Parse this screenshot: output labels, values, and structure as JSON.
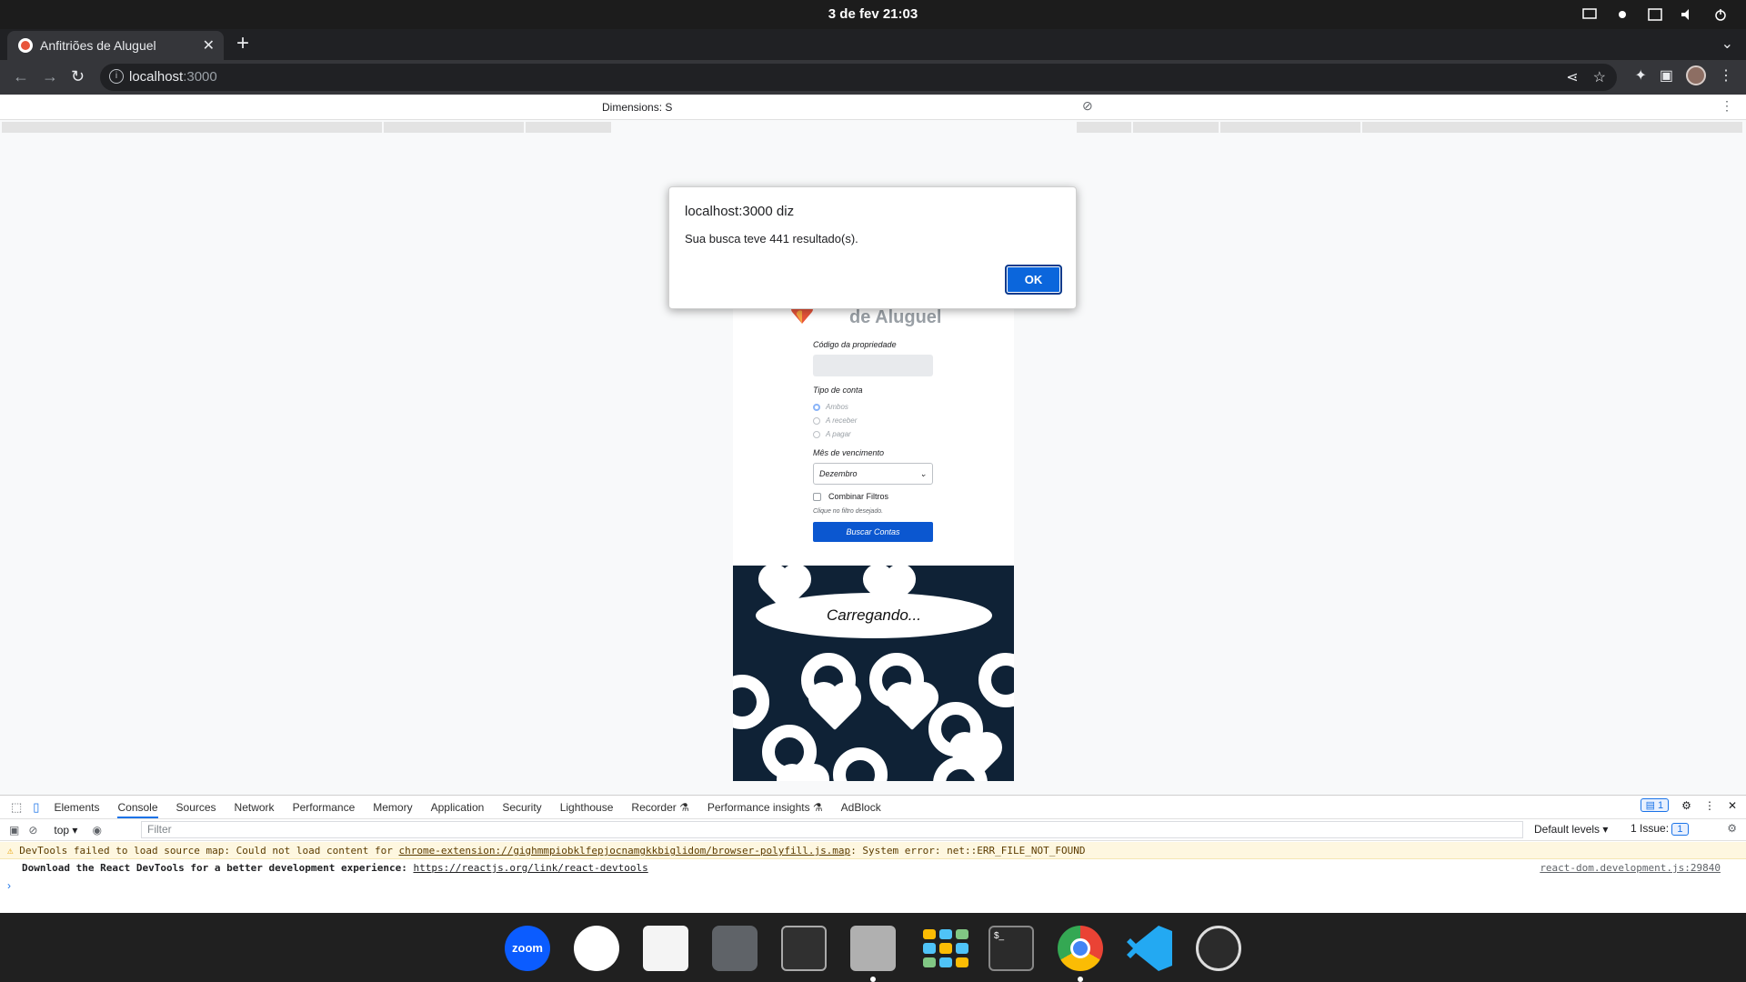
{
  "system": {
    "clock": "3 de fev  21:03"
  },
  "browser": {
    "tab_title": "Anfitriões de Aluguel",
    "url_host": "localhost",
    "url_port": ":3000"
  },
  "devmode": {
    "dimensions_label": "Dimensions: S"
  },
  "page": {
    "brand": "de Aluguel",
    "property_code_label": "Código da propriedade",
    "account_type_label": "Tipo de conta",
    "radio_options": [
      "Ambos",
      "A receber",
      "A pagar"
    ],
    "month_label": "Mês de vencimento",
    "month_value": "Dezembro",
    "combine_filters_label": "Combinar Filtros",
    "hint": "Clique no filtro desejado.",
    "search_button": "Buscar Contas",
    "loading_text": "Carregando..."
  },
  "alert": {
    "host": "localhost:3000 diz",
    "message": "Sua busca teve 441 resultado(s).",
    "ok_label": "OK"
  },
  "devtools": {
    "tabs": [
      "Elements",
      "Console",
      "Sources",
      "Network",
      "Performance",
      "Memory",
      "Application",
      "Security",
      "Lighthouse",
      "Recorder ⚗",
      "Performance insights ⚗",
      "AdBlock"
    ],
    "issues_badge": "1",
    "context": "top",
    "filter_placeholder": "Filter",
    "levels": "Default levels ▾",
    "issues_label": "1 Issue:",
    "issues_count": "1",
    "warn_prefix": "DevTools failed to load source map: Could not load content for ",
    "warn_link": "chrome-extension://gighmmpiobklfepjocnamgkkbiglidom/browser-polyfill.js.map",
    "warn_suffix": ": System error: net::ERR_FILE_NOT_FOUND",
    "log_text": "Download the React DevTools for a better development experience: ",
    "log_link": "https://reactjs.org/link/react-devtools",
    "log_source": "react-dom.development.js:29840"
  },
  "dock": {
    "zoom_label": "zoom",
    "terminal_label": "$_"
  }
}
